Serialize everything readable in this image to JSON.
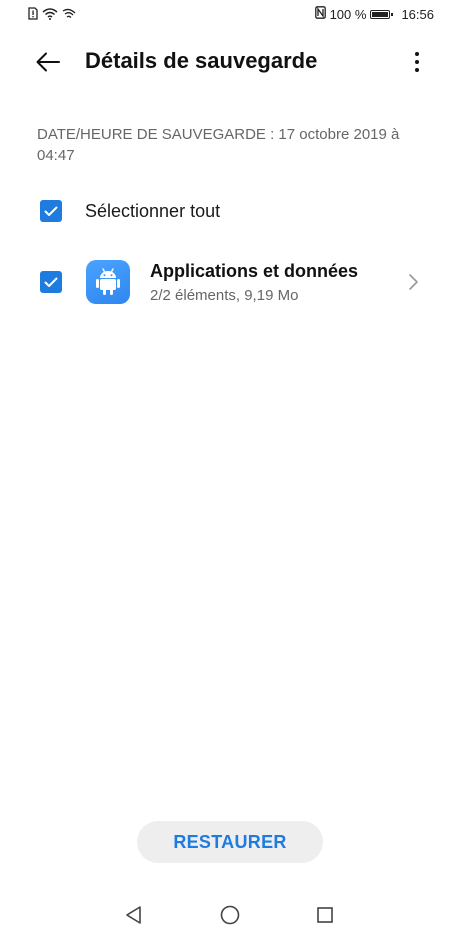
{
  "status_bar": {
    "battery_percent": "100 %",
    "time": "16:56"
  },
  "app_bar": {
    "title": "Détails de sauvegarde"
  },
  "backup_date": "DATE/HEURE DE SAUVEGARDE : 17 octobre 2019 à 04:47",
  "select_all": {
    "label": "Sélectionner tout",
    "checked": true
  },
  "items": [
    {
      "title": "Applications et données",
      "subtitle": "2/2 éléments, 9,19 Mo",
      "icon": "android-icon",
      "checked": true
    }
  ],
  "restore_button": {
    "label": "RESTAURER"
  },
  "colors": {
    "accent": "#1e7be0",
    "app_icon": "#3a93f5",
    "button_bg": "#eeeeee"
  }
}
